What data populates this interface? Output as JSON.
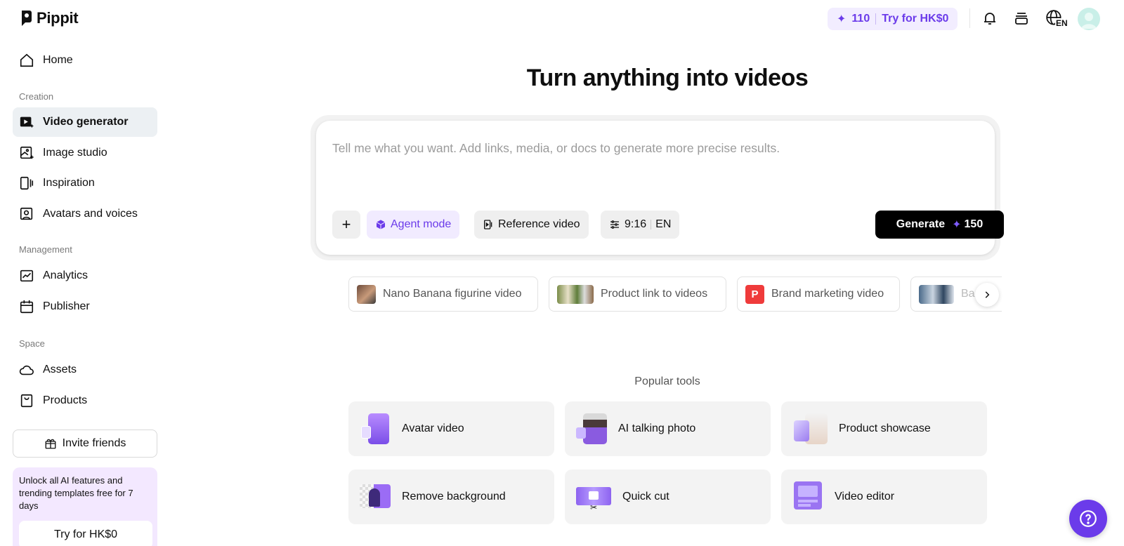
{
  "app": {
    "name": "Pippit"
  },
  "sidebar": {
    "home": "Home",
    "sections": {
      "creation": "Creation",
      "management": "Management",
      "space": "Space"
    },
    "items": {
      "video_generator": "Video generator",
      "image_studio": "Image studio",
      "inspiration": "Inspiration",
      "avatars_voices": "Avatars and voices",
      "analytics": "Analytics",
      "publisher": "Publisher",
      "assets": "Assets",
      "products": "Products"
    },
    "invite": "Invite friends",
    "promo": {
      "text": "Unlock all AI features and trending templates free for 7 days",
      "button": "Try for HK$0"
    }
  },
  "header": {
    "credits": "110",
    "trial": "Try for HK$0",
    "language": "EN"
  },
  "main": {
    "title": "Turn anything into videos",
    "prompt_placeholder": "Tell me what you want. Add links, media, or docs to generate more precise results.",
    "add": "+",
    "agent_mode": "Agent mode",
    "reference_video": "Reference video",
    "ratio": "9:16",
    "lang": "EN",
    "generate": "Generate",
    "generate_cost": "150",
    "suggestions": [
      "Nano Banana figurine video",
      "Product link to videos",
      "Brand marketing video",
      "Ba"
    ],
    "popular_label": "Popular tools",
    "tools": [
      "Avatar video",
      "AI talking photo",
      "Product showcase",
      "Remove background",
      "Quick cut",
      "Video editor"
    ]
  },
  "colors": {
    "accent": "#6b3bea",
    "active_nav": "#ecf0f3",
    "promo_bg": "#f3e8ff"
  }
}
